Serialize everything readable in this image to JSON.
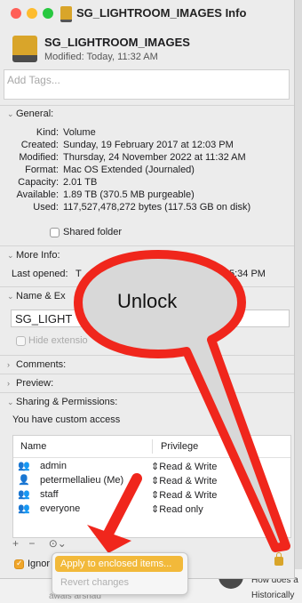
{
  "window": {
    "title": "SG_LIGHTROOM_IMAGES Info"
  },
  "header": {
    "name": "SG_LIGHTROOM_IMAGES",
    "modified": "Modified: Today, 11:32 AM"
  },
  "tags": {
    "placeholder": "Add Tags..."
  },
  "general": {
    "heading": "General:",
    "rows": [
      {
        "label": "Kind:",
        "value": "Volume"
      },
      {
        "label": "Created:",
        "value": "Sunday, 19 February 2017 at 12:03 PM"
      },
      {
        "label": "Modified:",
        "value": "Thursday, 24 November 2022 at 11:32 AM"
      },
      {
        "label": "Format:",
        "value": "Mac OS Extended (Journaled)"
      },
      {
        "label": "Capacity:",
        "value": "2.01 TB"
      },
      {
        "label": "Available:",
        "value": "1.89 TB (370.5 MB purgeable)"
      },
      {
        "label": "Used:",
        "value": "117,527,478,272 bytes (117.53 GB on disk)"
      }
    ],
    "shared_folder": "Shared folder"
  },
  "more_info": {
    "heading": "More Info:",
    "last_opened_label": "Last opened:",
    "last_opened_prefix": "T",
    "last_opened_suffix": "5:34 PM"
  },
  "name_ext": {
    "heading": "Name & Ex",
    "value": "SG_LIGHT",
    "hide_extension": "Hide extensio"
  },
  "comments": {
    "heading": "Comments:"
  },
  "preview": {
    "heading": "Preview:"
  },
  "sharing": {
    "heading": "Sharing & Permissions:",
    "access_text": "You have custom access",
    "col_name": "Name",
    "col_privilege": "Privilege",
    "rows": [
      {
        "name": "admin",
        "privilege": "Read & Write"
      },
      {
        "name": "petermellalieu (Me)",
        "privilege": "Read & Write"
      },
      {
        "name": "staff",
        "privilege": "Read & Write"
      },
      {
        "name": "everyone",
        "privilege": "Read only"
      }
    ],
    "ignore_label": "Ignor"
  },
  "callout": {
    "text": "Unlock"
  },
  "popup": {
    "apply": "Apply to enclosed items...",
    "revert": "Revert changes"
  },
  "background": {
    "line1": "How does a",
    "line2": "Historically",
    "line3": "awais arshad"
  },
  "colors": {
    "accent": "#f2b93a",
    "callout_arrow": "#f0261c"
  }
}
